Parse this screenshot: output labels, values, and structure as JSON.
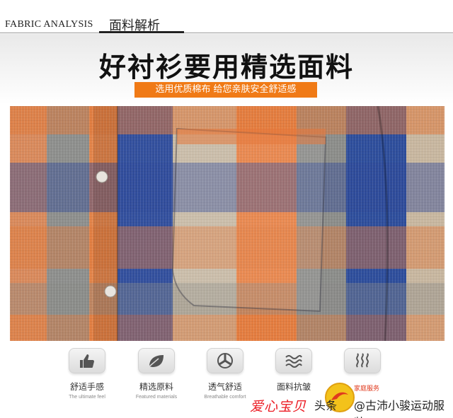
{
  "header": {
    "section_en": "FABRIC ANALYSIS",
    "section_cn": "面料解析"
  },
  "hero": {
    "title": "好衬衫要用精选面料",
    "subtitle": "选用优质棉布 给您亲肤安全舒适感"
  },
  "features": [
    {
      "icon": "thumbs-up-icon",
      "label": "舒适手感",
      "en": "The ultimate feel"
    },
    {
      "icon": "leaf-icon",
      "label": "精选原料",
      "en": "Featured materials"
    },
    {
      "icon": "fan-icon",
      "label": "透气舒适",
      "en": "Breathable comfort"
    },
    {
      "icon": "wave-icon",
      "label": "面料抗皱",
      "en": ""
    },
    {
      "icon": "steam-icon",
      "label": "",
      "en": ""
    }
  ],
  "watermark": {
    "aixin": "爱心宝贝",
    "toutiao": "头条",
    "store": "@古沛小骏运动服装",
    "chain": "家庭服务"
  },
  "colors": {
    "accent": "#f07a16",
    "plaid_blue": "#2b4a9a",
    "plaid_orange": "#e07a3c",
    "plaid_gray": "#8a8a86",
    "watermark_red": "#ec1c24"
  }
}
